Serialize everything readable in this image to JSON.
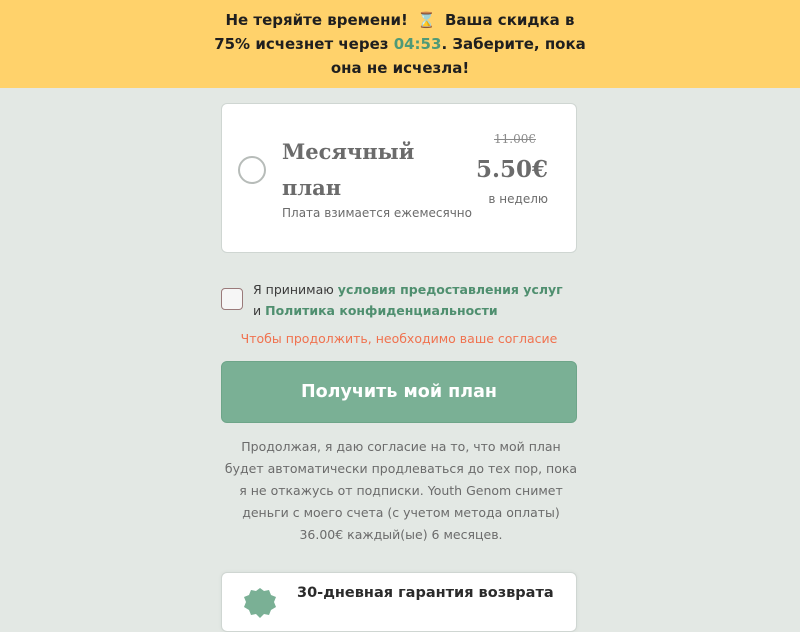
{
  "banner": {
    "text_before": "Не теряйте времени!",
    "icon": "hourglass-icon",
    "text_mid": "Ваша скидка в 75% исчезнет через",
    "timer": "04:53",
    "text_after": ". Заберите, пока она не исчезла!"
  },
  "plan": {
    "name": "Месячный план",
    "subtitle": "Плата взимается ежемесячно",
    "old_price": "11.00€",
    "price": "5.50€",
    "period": "в неделю",
    "selected": false
  },
  "consent": {
    "checked": false,
    "text_prefix": "Я принимаю",
    "terms_link": "условия предоставления услуг",
    "and": "и",
    "privacy_link": "Политика конфиденциальности",
    "error": "Чтобы продолжить, необходимо ваше согласие"
  },
  "cta": {
    "label": "Получить мой план"
  },
  "disclaimer": "Продолжая, я даю согласие на то, что мой план будет автоматически продлеваться до тех пор, пока я не откажусь от подписки. Youth Genom снимет деньги с моего счета (с учетом метода оплаты) 36.00€ каждый(ые) 6 месяцев.",
  "guarantee": {
    "title": "30-дневная гарантия возврата",
    "icon": "badge-icon"
  },
  "colors": {
    "banner_bg": "#ffd26b",
    "accent_green": "#7ab095",
    "link_green": "#4f8f6f",
    "error": "#f0724f",
    "page_bg": "#e3e8e4"
  }
}
